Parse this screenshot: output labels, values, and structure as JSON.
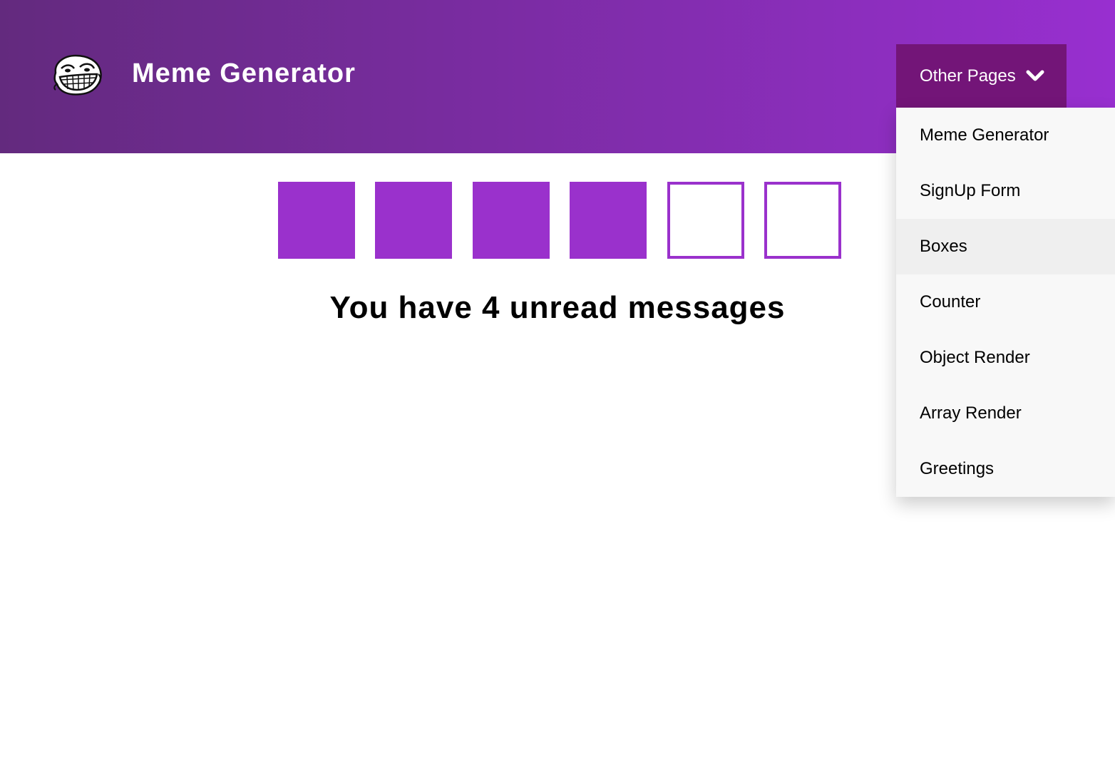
{
  "header": {
    "title": "Meme Generator",
    "logo_icon": "troll-face-icon",
    "gradient_start": "#632a7e",
    "gradient_end": "#982fd0"
  },
  "dropdown": {
    "label": "Other Pages",
    "icon": "chevron-down-icon",
    "background": "#731578",
    "items": [
      {
        "label": "Meme Generator"
      },
      {
        "label": "SignUp Form"
      },
      {
        "label": "Boxes",
        "hovered": true
      },
      {
        "label": "Counter"
      },
      {
        "label": "Object Render"
      },
      {
        "label": "Array Render"
      },
      {
        "label": "Greetings"
      }
    ]
  },
  "boxes": {
    "color": "#9a31cc",
    "items": [
      {
        "filled": true
      },
      {
        "filled": true
      },
      {
        "filled": true
      },
      {
        "filled": true
      },
      {
        "filled": false
      },
      {
        "filled": false
      }
    ]
  },
  "message": "You have 4 unread messages"
}
